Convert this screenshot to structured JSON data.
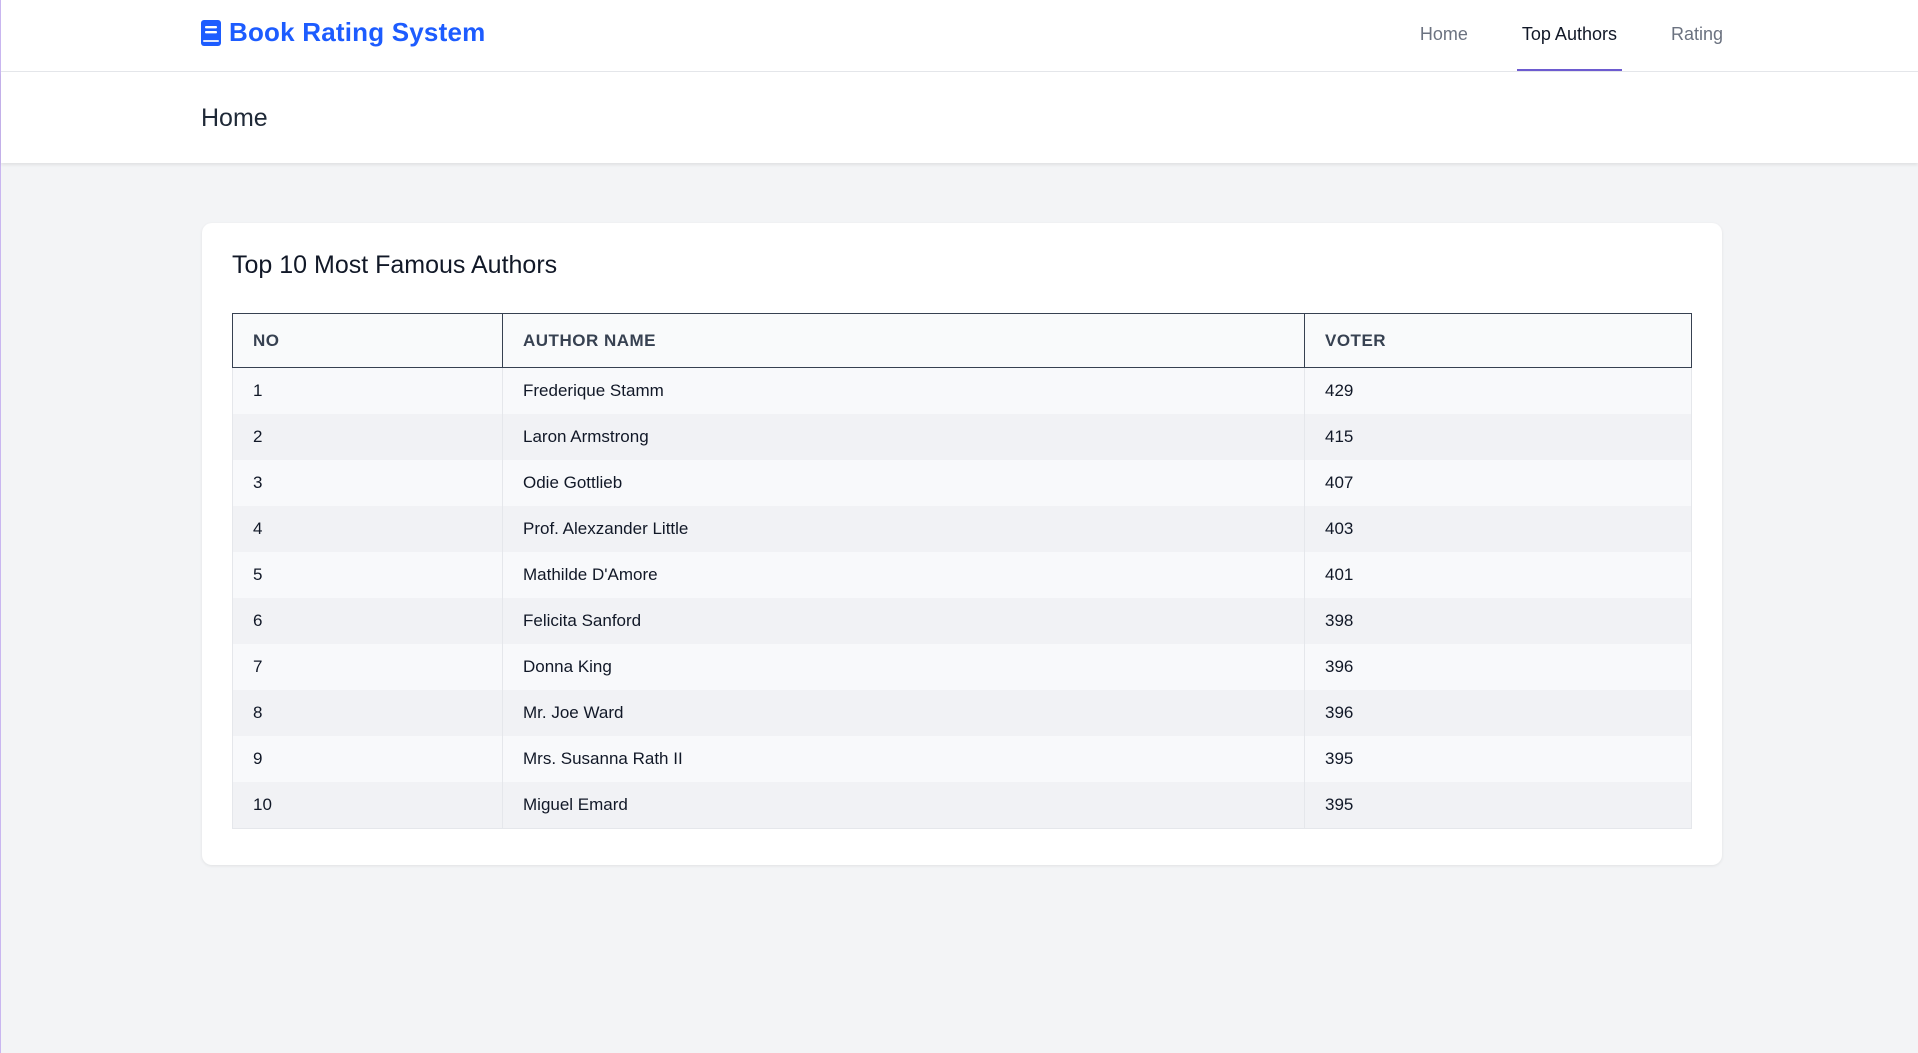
{
  "brand": {
    "name": "Book Rating System",
    "icon": "book-icon",
    "color": "#1d5cff"
  },
  "nav": {
    "items": [
      {
        "label": "Home",
        "active": false
      },
      {
        "label": "Top Authors",
        "active": true
      },
      {
        "label": "Rating",
        "active": false
      }
    ],
    "active_indicator_color": "#6d5bd0"
  },
  "header": {
    "title": "Home"
  },
  "card": {
    "title": "Top 10 Most Famous Authors"
  },
  "table": {
    "columns": [
      "NO",
      "AUTHOR NAME",
      "VOTER"
    ],
    "rows": [
      {
        "no": "1",
        "name": "Frederique Stamm",
        "voter": "429"
      },
      {
        "no": "2",
        "name": "Laron Armstrong",
        "voter": "415"
      },
      {
        "no": "3",
        "name": "Odie Gottlieb",
        "voter": "407"
      },
      {
        "no": "4",
        "name": "Prof. Alexzander Little",
        "voter": "403"
      },
      {
        "no": "5",
        "name": "Mathilde D'Amore",
        "voter": "401"
      },
      {
        "no": "6",
        "name": "Felicita Sanford",
        "voter": "398"
      },
      {
        "no": "7",
        "name": "Donna King",
        "voter": "396"
      },
      {
        "no": "8",
        "name": "Mr. Joe Ward",
        "voter": "396"
      },
      {
        "no": "9",
        "name": "Mrs. Susanna Rath II",
        "voter": "395"
      },
      {
        "no": "10",
        "name": "Miguel Emard",
        "voter": "395"
      }
    ]
  }
}
